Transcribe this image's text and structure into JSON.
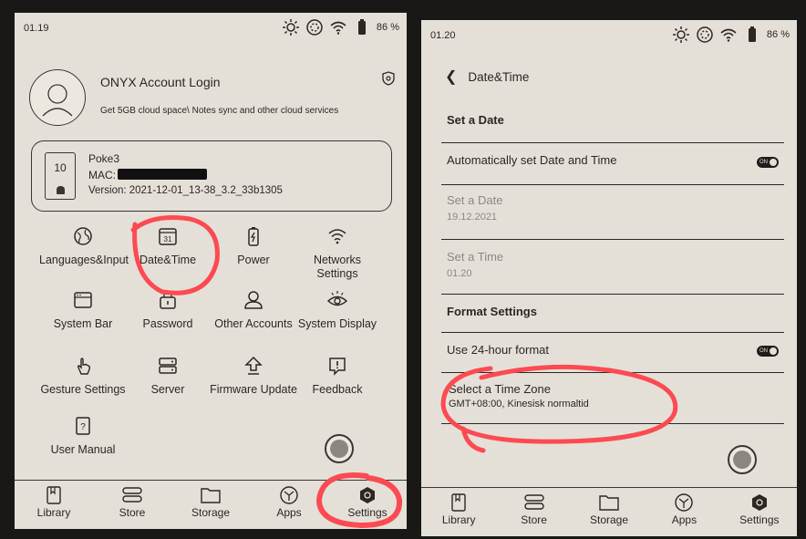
{
  "left": {
    "status": {
      "time": "01.19",
      "battery": "86 %"
    },
    "account": {
      "title": "ONYX Account Login",
      "subtitle": "Get 5GB cloud space\\ Notes sync and other cloud services"
    },
    "device": {
      "icon_number": "10",
      "name": "Poke3",
      "mac_label": "MAC:",
      "version": "Version: 2021-12-01_13-38_3.2_33b1305"
    },
    "calendar_day": "31",
    "grid": [
      {
        "id": "languages",
        "label": "Languages&Input",
        "icon": "globe-icon"
      },
      {
        "id": "datetime",
        "label": "Date&Time",
        "icon": "calendar-icon"
      },
      {
        "id": "power",
        "label": "Power",
        "icon": "battery-icon"
      },
      {
        "id": "networks",
        "label": "Networks Settings",
        "icon": "wifi-icon"
      },
      {
        "id": "systembar",
        "label": "System Bar",
        "icon": "window-icon"
      },
      {
        "id": "password",
        "label": "Password",
        "icon": "lock-icon"
      },
      {
        "id": "accounts",
        "label": "Other Accounts",
        "icon": "person-icon"
      },
      {
        "id": "display",
        "label": "System Display",
        "icon": "eye-icon"
      },
      {
        "id": "gesture",
        "label": "Gesture Settings",
        "icon": "hand-icon"
      },
      {
        "id": "server",
        "label": "Server",
        "icon": "server-icon"
      },
      {
        "id": "firmware",
        "label": "Firmware Update",
        "icon": "upload-icon"
      },
      {
        "id": "feedback",
        "label": "Feedback",
        "icon": "feedback-icon"
      },
      {
        "id": "manual",
        "label": "User Manual",
        "icon": "manual-icon"
      }
    ],
    "nav": [
      "Library",
      "Store",
      "Storage",
      "Apps",
      "Settings"
    ]
  },
  "right": {
    "status": {
      "time": "01.20",
      "battery": "86 %"
    },
    "header": "Date&Time",
    "set_date_section": "Set a Date",
    "auto_label": "Automatically set Date and Time",
    "toggle_on": "ON",
    "set_date_label": "Set a Date",
    "set_date_value": "19.12.2021",
    "set_time_label": "Set a Time",
    "set_time_value": "01.20",
    "format_section": "Format Settings",
    "use24_label": "Use 24-hour format",
    "timezone_label": "Select a Time Zone",
    "timezone_value": "GMT+08:00, Kinesisk normaltid",
    "nav": [
      "Library",
      "Store",
      "Storage",
      "Apps",
      "Settings"
    ]
  },
  "colors": {
    "screen": "#e4e0d8",
    "ink": "#2b2824",
    "muted": "#8c8984",
    "annotation": "#ff4a52"
  }
}
